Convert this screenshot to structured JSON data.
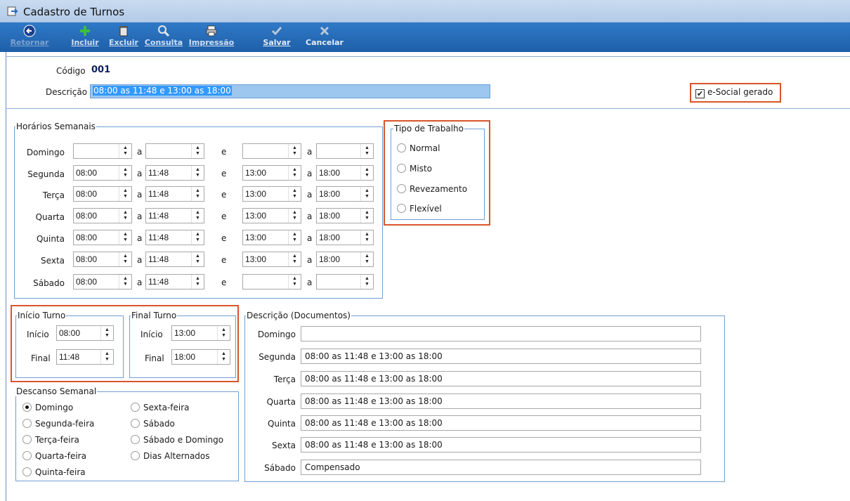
{
  "window": {
    "title": "Cadastro de Turnos"
  },
  "toolbar": {
    "retornar": "Retornar",
    "incluir": "Incluir",
    "excluir": "Excluir",
    "consulta": "Consulta",
    "impressao": "Impressão",
    "salvar": "Salvar",
    "cancelar": "Cancelar"
  },
  "header": {
    "codigo_label": "Código",
    "codigo_value": "001",
    "descricao_label": "Descrição",
    "descricao_value": "08:00 as 11:48 e 13:00 as 18:00",
    "esocial_label": "e-Social gerado",
    "esocial_checked": true
  },
  "horarios": {
    "title": "Horários Semanais",
    "sep_a": "a",
    "sep_e": "e",
    "days": [
      {
        "label": "Domingo",
        "t1": "",
        "t2": "",
        "t3": "",
        "t4": ""
      },
      {
        "label": "Segunda",
        "t1": "08:00",
        "t2": "11:48",
        "t3": "13:00",
        "t4": "18:00"
      },
      {
        "label": "Terça",
        "t1": "08:00",
        "t2": "11:48",
        "t3": "13:00",
        "t4": "18:00"
      },
      {
        "label": "Quarta",
        "t1": "08:00",
        "t2": "11:48",
        "t3": "13:00",
        "t4": "18:00"
      },
      {
        "label": "Quinta",
        "t1": "08:00",
        "t2": "11:48",
        "t3": "13:00",
        "t4": "18:00"
      },
      {
        "label": "Sexta",
        "t1": "08:00",
        "t2": "11:48",
        "t3": "13:00",
        "t4": "18:00"
      },
      {
        "label": "Sábado",
        "t1": "08:00",
        "t2": "11:48",
        "t3": "",
        "t4": ""
      }
    ]
  },
  "tipo_trabalho": {
    "title": "Tipo de Trabalho",
    "options": [
      "Normal",
      "Misto",
      "Revezamento",
      "Flexível"
    ]
  },
  "inicio_turno": {
    "title": "Início Turno",
    "inicio_label": "Início",
    "inicio": "08:00",
    "final_label": "Final",
    "final": "11:48"
  },
  "final_turno": {
    "title": "Final Turno",
    "inicio_label": "Início",
    "inicio": "13:00",
    "final_label": "Final",
    "final": "18:00"
  },
  "descanso": {
    "title": "Descanso Semanal",
    "col1": [
      "Domingo",
      "Segunda-feira",
      "Terça-feira",
      "Quarta-feira",
      "Quinta-feira"
    ],
    "col2": [
      "Sexta-feira",
      "Sábado",
      "Sábado e Domingo",
      "Dias Alternados"
    ],
    "selected": "Domingo"
  },
  "descricao_docs": {
    "title": "Descrição (Documentos)",
    "rows": [
      {
        "label": "Domingo",
        "value": ""
      },
      {
        "label": "Segunda",
        "value": "08:00 as 11:48 e 13:00 as 18:00"
      },
      {
        "label": "Terça",
        "value": "08:00 as 11:48 e 13:00 as 18:00"
      },
      {
        "label": "Quarta",
        "value": "08:00 as 11:48 e 13:00 as 18:00"
      },
      {
        "label": "Quinta",
        "value": "08:00 as 11:48 e 13:00 as 18:00"
      },
      {
        "label": "Sexta",
        "value": "08:00 as 11:48 e 13:00 as 18:00"
      },
      {
        "label": "Sábado",
        "value": "Compensado"
      }
    ]
  }
}
